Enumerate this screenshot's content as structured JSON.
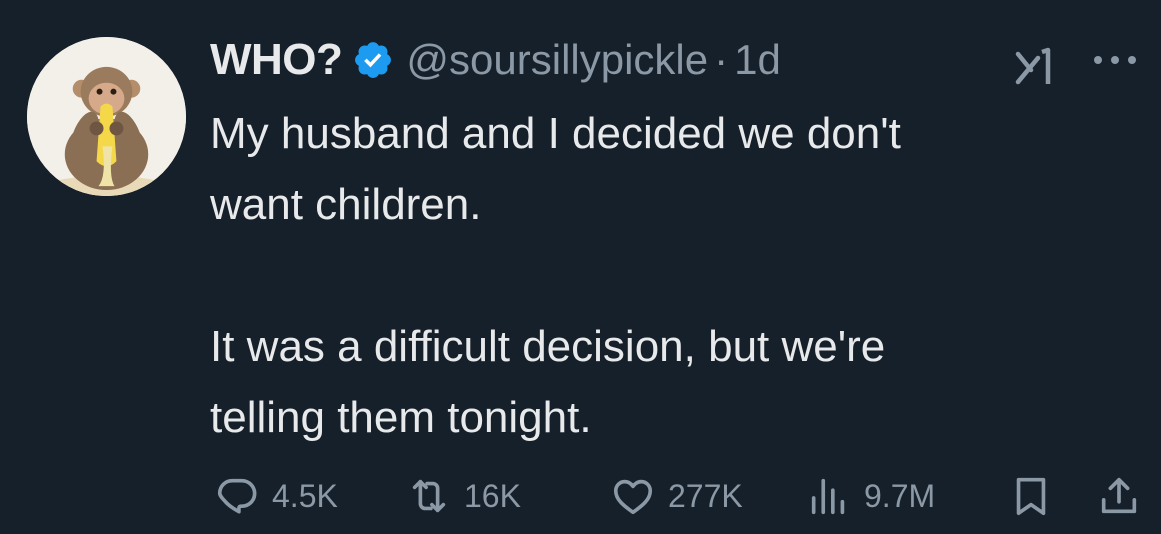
{
  "tweet": {
    "author": {
      "display_name": "WHO?",
      "handle": "@soursillypickle",
      "separator": "·",
      "time": "1d",
      "verified": true,
      "verified_color": "#1d9bf0"
    },
    "text_lines": {
      "line1": "My husband and I decided we don't",
      "line2": "want children.",
      "line3": "It was a difficult decision, but we're",
      "line4": "telling them tonight."
    },
    "stats": {
      "replies": "4.5K",
      "reposts": "16K",
      "likes": "277K",
      "views": "9.7M"
    },
    "icons": {
      "avatar": "monkey-eating-banana",
      "grok": "grok-icon",
      "more": "more-icon",
      "reply": "reply-icon",
      "repost": "repost-icon",
      "like": "heart-icon",
      "views": "views-icon",
      "bookmark": "bookmark-icon",
      "share": "share-icon"
    }
  },
  "colors": {
    "background": "#16202a",
    "text_primary": "#e7e9ea",
    "text_secondary": "#8b98a5"
  }
}
